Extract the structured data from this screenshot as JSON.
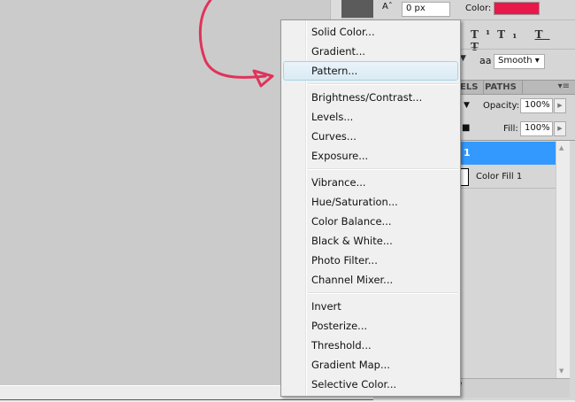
{
  "character_panel": {
    "baseline_shift": "0 px",
    "color_label": "Color:",
    "color_value": "#e8184a",
    "antialias": "Smooth",
    "aa_icon": "aa"
  },
  "layers_panel": {
    "tabs": [
      "ELS",
      "PATHS"
    ],
    "opacity_label": "Opacity:",
    "opacity": "100%",
    "fill_label": "Fill:",
    "fill": "100%",
    "layers": [
      {
        "name": "1",
        "selected": true
      },
      {
        "name": "Color Fill 1",
        "selected": false
      }
    ]
  },
  "menu": {
    "groups": [
      [
        "Solid Color...",
        "Gradient...",
        "Pattern..."
      ],
      [
        "Brightness/Contrast...",
        "Levels...",
        "Curves...",
        "Exposure..."
      ],
      [
        "Vibrance...",
        "Hue/Saturation...",
        "Color Balance...",
        "Black & White...",
        "Photo Filter...",
        "Channel Mixer..."
      ],
      [
        "Invert",
        "Posterize...",
        "Threshold...",
        "Gradient Map...",
        "Selective Color..."
      ]
    ],
    "highlighted": "Pattern..."
  },
  "colors": {
    "arrow": "#e0335a",
    "selection": "#3399ff"
  }
}
